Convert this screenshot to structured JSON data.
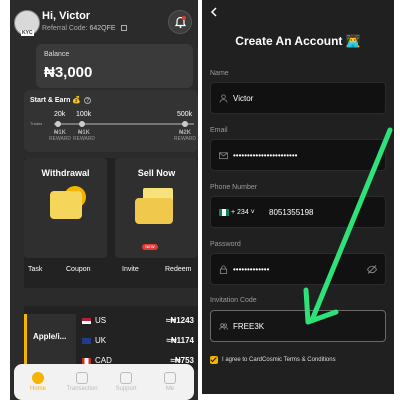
{
  "home": {
    "greeting": "Hi, Victor",
    "referral_label": "Referral Code:",
    "referral_code": "642QFE",
    "avatar_tag": "KYC",
    "balance_label": "Balance",
    "balance_value": "₦3,000",
    "start_earn_title": "Start & Earn 💰",
    "tiers": [
      "20k",
      "100k",
      "500k"
    ],
    "trades_label": "Trades",
    "rewards": [
      {
        "amount": "₦1K",
        "label": "REWARD"
      },
      {
        "amount": "₦1K",
        "label": "REWARD"
      },
      {
        "amount": "₦2K",
        "label": "REWARD"
      }
    ],
    "tiles": [
      {
        "title": "Withdrawal"
      },
      {
        "title": "Sell Now"
      }
    ],
    "new_badge": "NEW",
    "actions": [
      "Task",
      "Coupon",
      "Invite",
      "Redeem"
    ],
    "giftcard_label": "Apple/i...",
    "rates": [
      {
        "country": "US",
        "rate": "≈₦1243"
      },
      {
        "country": "UK",
        "rate": "≈₦1174"
      },
      {
        "country": "CAD",
        "rate": "≈₦753"
      }
    ],
    "nav": [
      "Home",
      "Transaction",
      "Support",
      "Me"
    ],
    "accent": "#f4b400"
  },
  "signup": {
    "title": "Create An Account 👨‍💻",
    "name_label": "Name",
    "name_value": "Victor",
    "email_label": "Email",
    "email_value": "•••••••••••••••••••••••",
    "phone_label": "Phone Number",
    "country_code": "+ 234 ˅",
    "phone_value": "8051355198",
    "password_label": "Password",
    "password_value": "•••••••••••••",
    "invite_label": "Invitation Code",
    "invite_value": "FREE3K",
    "terms": "I agree to CardCosmic Terms & Conditions",
    "arrow_color": "#2ee27a"
  }
}
